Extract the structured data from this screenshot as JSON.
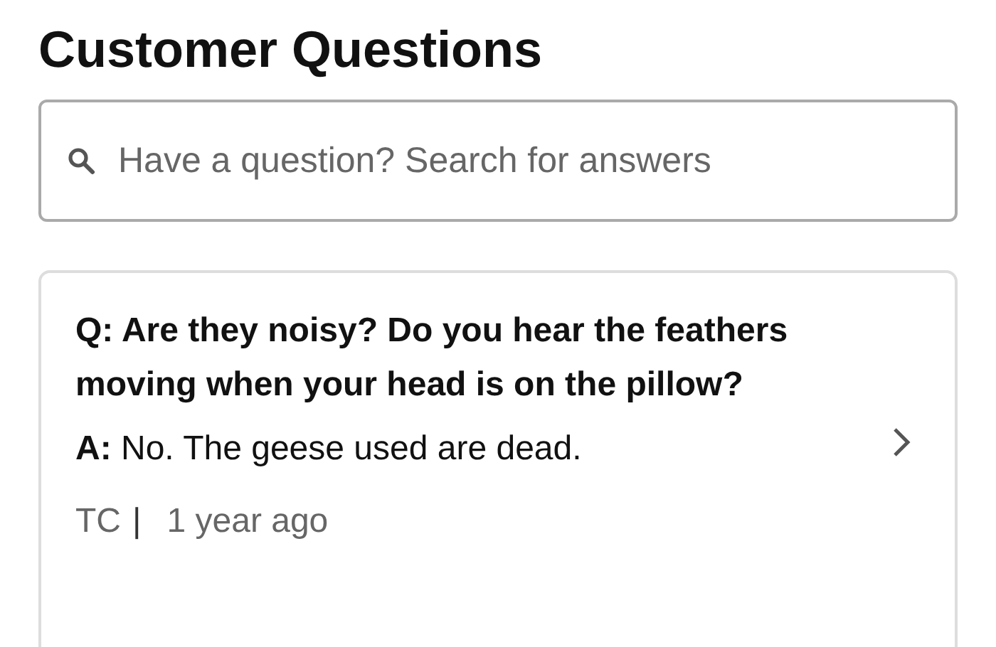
{
  "title": "Customer Questions",
  "search": {
    "placeholder": "Have a question? Search for answers"
  },
  "question_card": {
    "question": "Q: Are they noisy? Do you hear the feathers moving when your head is on the pillow?",
    "answer": "**A:** No. The geese used are dead.",
    "author": "TC",
    "separator": "|",
    "time": "1 year ago"
  }
}
